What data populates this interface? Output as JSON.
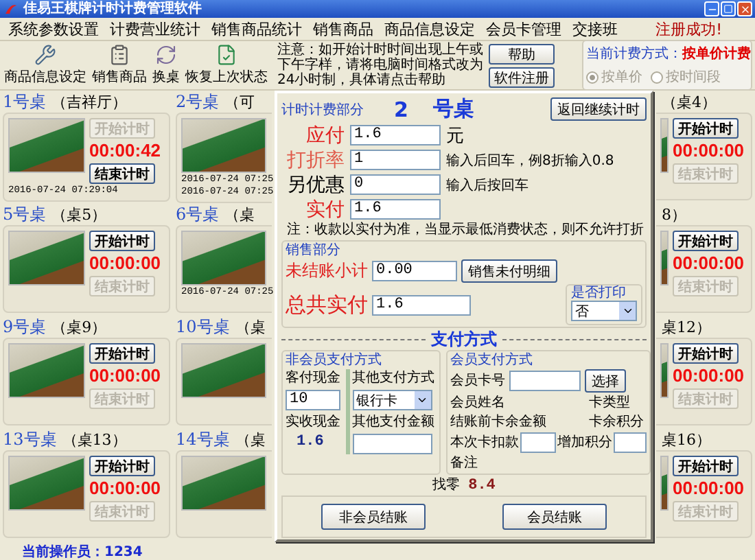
{
  "window": {
    "title": "佳易王棋牌计时计费管理软件"
  },
  "menu": [
    "系统参数设置",
    "计费营业统计",
    "销售商品统计",
    "销售商品",
    "商品信息设定",
    "会员卡管理",
    "交接班"
  ],
  "register_status": "注册成功!",
  "toolbar": [
    {
      "label": "商品信息设定",
      "kind": "wrench"
    },
    {
      "label": "销售商品",
      "kind": "clipboard"
    },
    {
      "label": "换桌",
      "kind": "swap"
    },
    {
      "label": "恢复上次状态",
      "kind": "check"
    }
  ],
  "notice": {
    "text": "注意：如开始计时时间出现上午或下午字样，请将电脑时间格式改为24小时制，具体请点击帮助",
    "buttons": [
      "帮助",
      "软件注册"
    ]
  },
  "billing_mode": {
    "label": "当前计费方式：",
    "value": "按单价计费",
    "options": [
      {
        "label": "按单价",
        "selected": true
      },
      {
        "label": "按时间段",
        "selected": false
      }
    ]
  },
  "table_columns": [
    {
      "kind": "full",
      "cards": [
        {
          "number": "1号桌",
          "name": "（吉祥厅）",
          "timer": "00:00:42",
          "start_button": {
            "label": "开始计时",
            "disabled": true
          },
          "stop_button": {
            "label": "结束计时",
            "disabled": false
          },
          "dates": [
            "2016-07-24 07:29:04"
          ]
        },
        {
          "number": "5号桌",
          "name": "（桌5）",
          "timer": "00:00:00",
          "start_button": {
            "label": "开始计时",
            "disabled": false
          },
          "stop_button": {
            "label": "结束计时",
            "disabled": true
          }
        },
        {
          "number": "9号桌",
          "name": "（桌9）",
          "timer": "00:00:00",
          "start_button": {
            "label": "开始计时",
            "disabled": false
          },
          "stop_button": {
            "label": "结束计时",
            "disabled": true
          }
        },
        {
          "number": "13号桌",
          "name": "（桌13）",
          "timer": "00:00:00",
          "start_button": {
            "label": "开始计时",
            "disabled": false
          },
          "stop_button": {
            "label": "结束计时",
            "disabled": true
          }
        }
      ]
    },
    {
      "kind": "left_part",
      "cards": [
        {
          "number": "2号桌",
          "name": "（可",
          "dates": [
            "2016-07-24 07:25",
            "2016-07-24 07:25"
          ]
        },
        {
          "number": "6号桌",
          "name": "（桌",
          "dates": [
            "2016-07-24 07:25"
          ]
        },
        {
          "number": "10号桌",
          "name": "（桌"
        },
        {
          "number": "14号桌",
          "name": "（桌"
        }
      ]
    },
    {
      "kind": "dialog"
    },
    {
      "kind": "right_part",
      "cards": [
        {
          "name": "（桌4）",
          "timer": "00:00:00",
          "start_button": {
            "label": "开始计时",
            "disabled": false
          },
          "stop_button": {
            "label": "结束计时",
            "disabled": true
          }
        },
        {
          "name": "8）",
          "timer": "00:00:00",
          "start_button": {
            "label": "开始计时",
            "disabled": false
          },
          "stop_button": {
            "label": "结束计时",
            "disabled": true
          }
        },
        {
          "name": "桌12）",
          "timer": "00:00:00",
          "start_button": {
            "label": "开始计时",
            "disabled": false
          },
          "stop_button": {
            "label": "结束计时",
            "disabled": true
          }
        },
        {
          "name": "桌16）",
          "timer": "00:00:00",
          "start_button": {
            "label": "开始计时",
            "disabled": false
          },
          "stop_button": {
            "label": "结束计时",
            "disabled": true
          }
        }
      ]
    }
  ],
  "checkout": {
    "section_title": "计时计费部分",
    "table_no": "2",
    "table_suffix": "号桌",
    "return_button": "返回继续计时",
    "fields": [
      {
        "label": "应付",
        "value": "1.6",
        "unit": "元",
        "color": "#e02020"
      },
      {
        "label": "打折率",
        "value": "1",
        "hint": "输入后回车，例8折输入0.8",
        "color": "#e05a4a"
      },
      {
        "label": "另优惠",
        "value": "0",
        "hint": "输入后按回车",
        "color": "#000000"
      },
      {
        "label": "实付",
        "value": "1.6",
        "color": "#e02020"
      }
    ],
    "note": "注：收款以实付为准，当显示最低消费状态，则不允许打折",
    "sales": {
      "title": "销售部分",
      "subtotal_label": "未结账小计",
      "subtotal": "0.00",
      "detail_button": "销售未付明细",
      "total_label": "总共实付",
      "total": "1.6",
      "print_label": "是否打印",
      "print_value": "否"
    },
    "payment_title": "支付方式",
    "non_member": {
      "title": "非会员支付方式",
      "cash_label": "客付现金",
      "cash": "10",
      "received_label": "实收现金",
      "received": "1.6",
      "other_label": "其他支付方式",
      "other_method": "银行卡",
      "other_amount_label": "其他支付金额"
    },
    "member": {
      "title": "会员支付方式",
      "card_label": "会员卡号",
      "select_button": "选择",
      "name_label": "会员姓名",
      "card_type_label": "卡类型",
      "balance_label": "结账前卡余金额",
      "points_label": "卡余积分",
      "deduct_label": "本次卡扣款",
      "add_points_label": "增加积分",
      "remark_label": "备注"
    },
    "change_label": "找零",
    "change": "8.4",
    "buttons": [
      "非会员结账",
      "会员结账"
    ]
  },
  "status_bar": {
    "operator": "当前操作员：1234"
  }
}
